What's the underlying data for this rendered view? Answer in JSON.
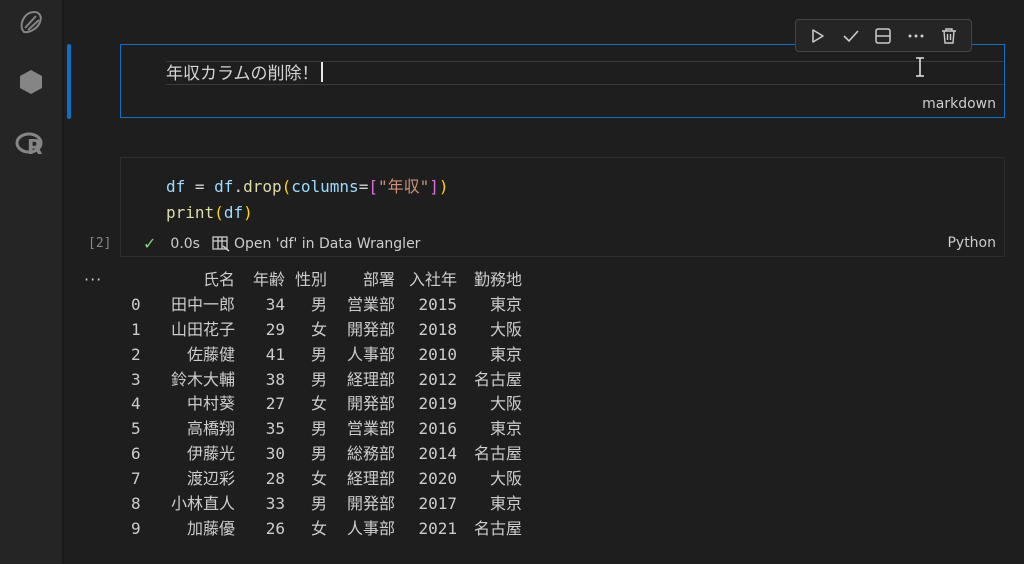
{
  "activity_bar": {
    "icons": [
      "copilot-icon",
      "hexagon-icon",
      "r-language-icon"
    ]
  },
  "cell_toolbar": {
    "buttons": [
      "run-icon",
      "check-icon",
      "split-cell-icon",
      "more-icon",
      "delete-icon"
    ]
  },
  "markdown_cell": {
    "text": "年収カラムの削除！",
    "language": "markdown"
  },
  "code_cell": {
    "execution_count": "[2]",
    "status": "0.0s",
    "data_wrangler_label": "Open 'df' in Data Wrangler",
    "language": "Python",
    "code": {
      "line1": [
        "df",
        " = ",
        "df",
        ".",
        "drop",
        "(",
        "columns",
        "=",
        "[",
        "\"年収\"",
        "]",
        ")"
      ],
      "line2": [
        "print",
        "(",
        "df",
        ")"
      ]
    }
  },
  "output": {
    "more_label": "···",
    "headers": [
      "氏名",
      "年齢",
      "性別",
      "部署",
      "入社年",
      "勤務地"
    ],
    "rows": [
      [
        "0",
        "田中一郎",
        "34",
        "男",
        "営業部",
        "2015",
        "東京"
      ],
      [
        "1",
        "山田花子",
        "29",
        "女",
        "開発部",
        "2018",
        "大阪"
      ],
      [
        "2",
        "佐藤健",
        "41",
        "男",
        "人事部",
        "2010",
        "東京"
      ],
      [
        "3",
        "鈴木大輔",
        "38",
        "男",
        "経理部",
        "2012",
        "名古屋"
      ],
      [
        "4",
        "中村葵",
        "27",
        "女",
        "開発部",
        "2019",
        "大阪"
      ],
      [
        "5",
        "高橋翔",
        "35",
        "男",
        "営業部",
        "2016",
        "東京"
      ],
      [
        "6",
        "伊藤光",
        "30",
        "男",
        "総務部",
        "2014",
        "名古屋"
      ],
      [
        "7",
        "渡辺彩",
        "28",
        "女",
        "経理部",
        "2020",
        "大阪"
      ],
      [
        "8",
        "小林直人",
        "33",
        "男",
        "開発部",
        "2017",
        "東京"
      ],
      [
        "9",
        "加藤優",
        "26",
        "女",
        "人事部",
        "2021",
        "名古屋"
      ]
    ]
  },
  "colors": {
    "background": "#1e1e1e",
    "focus_border": "#0e70c0",
    "success": "#89d185"
  }
}
